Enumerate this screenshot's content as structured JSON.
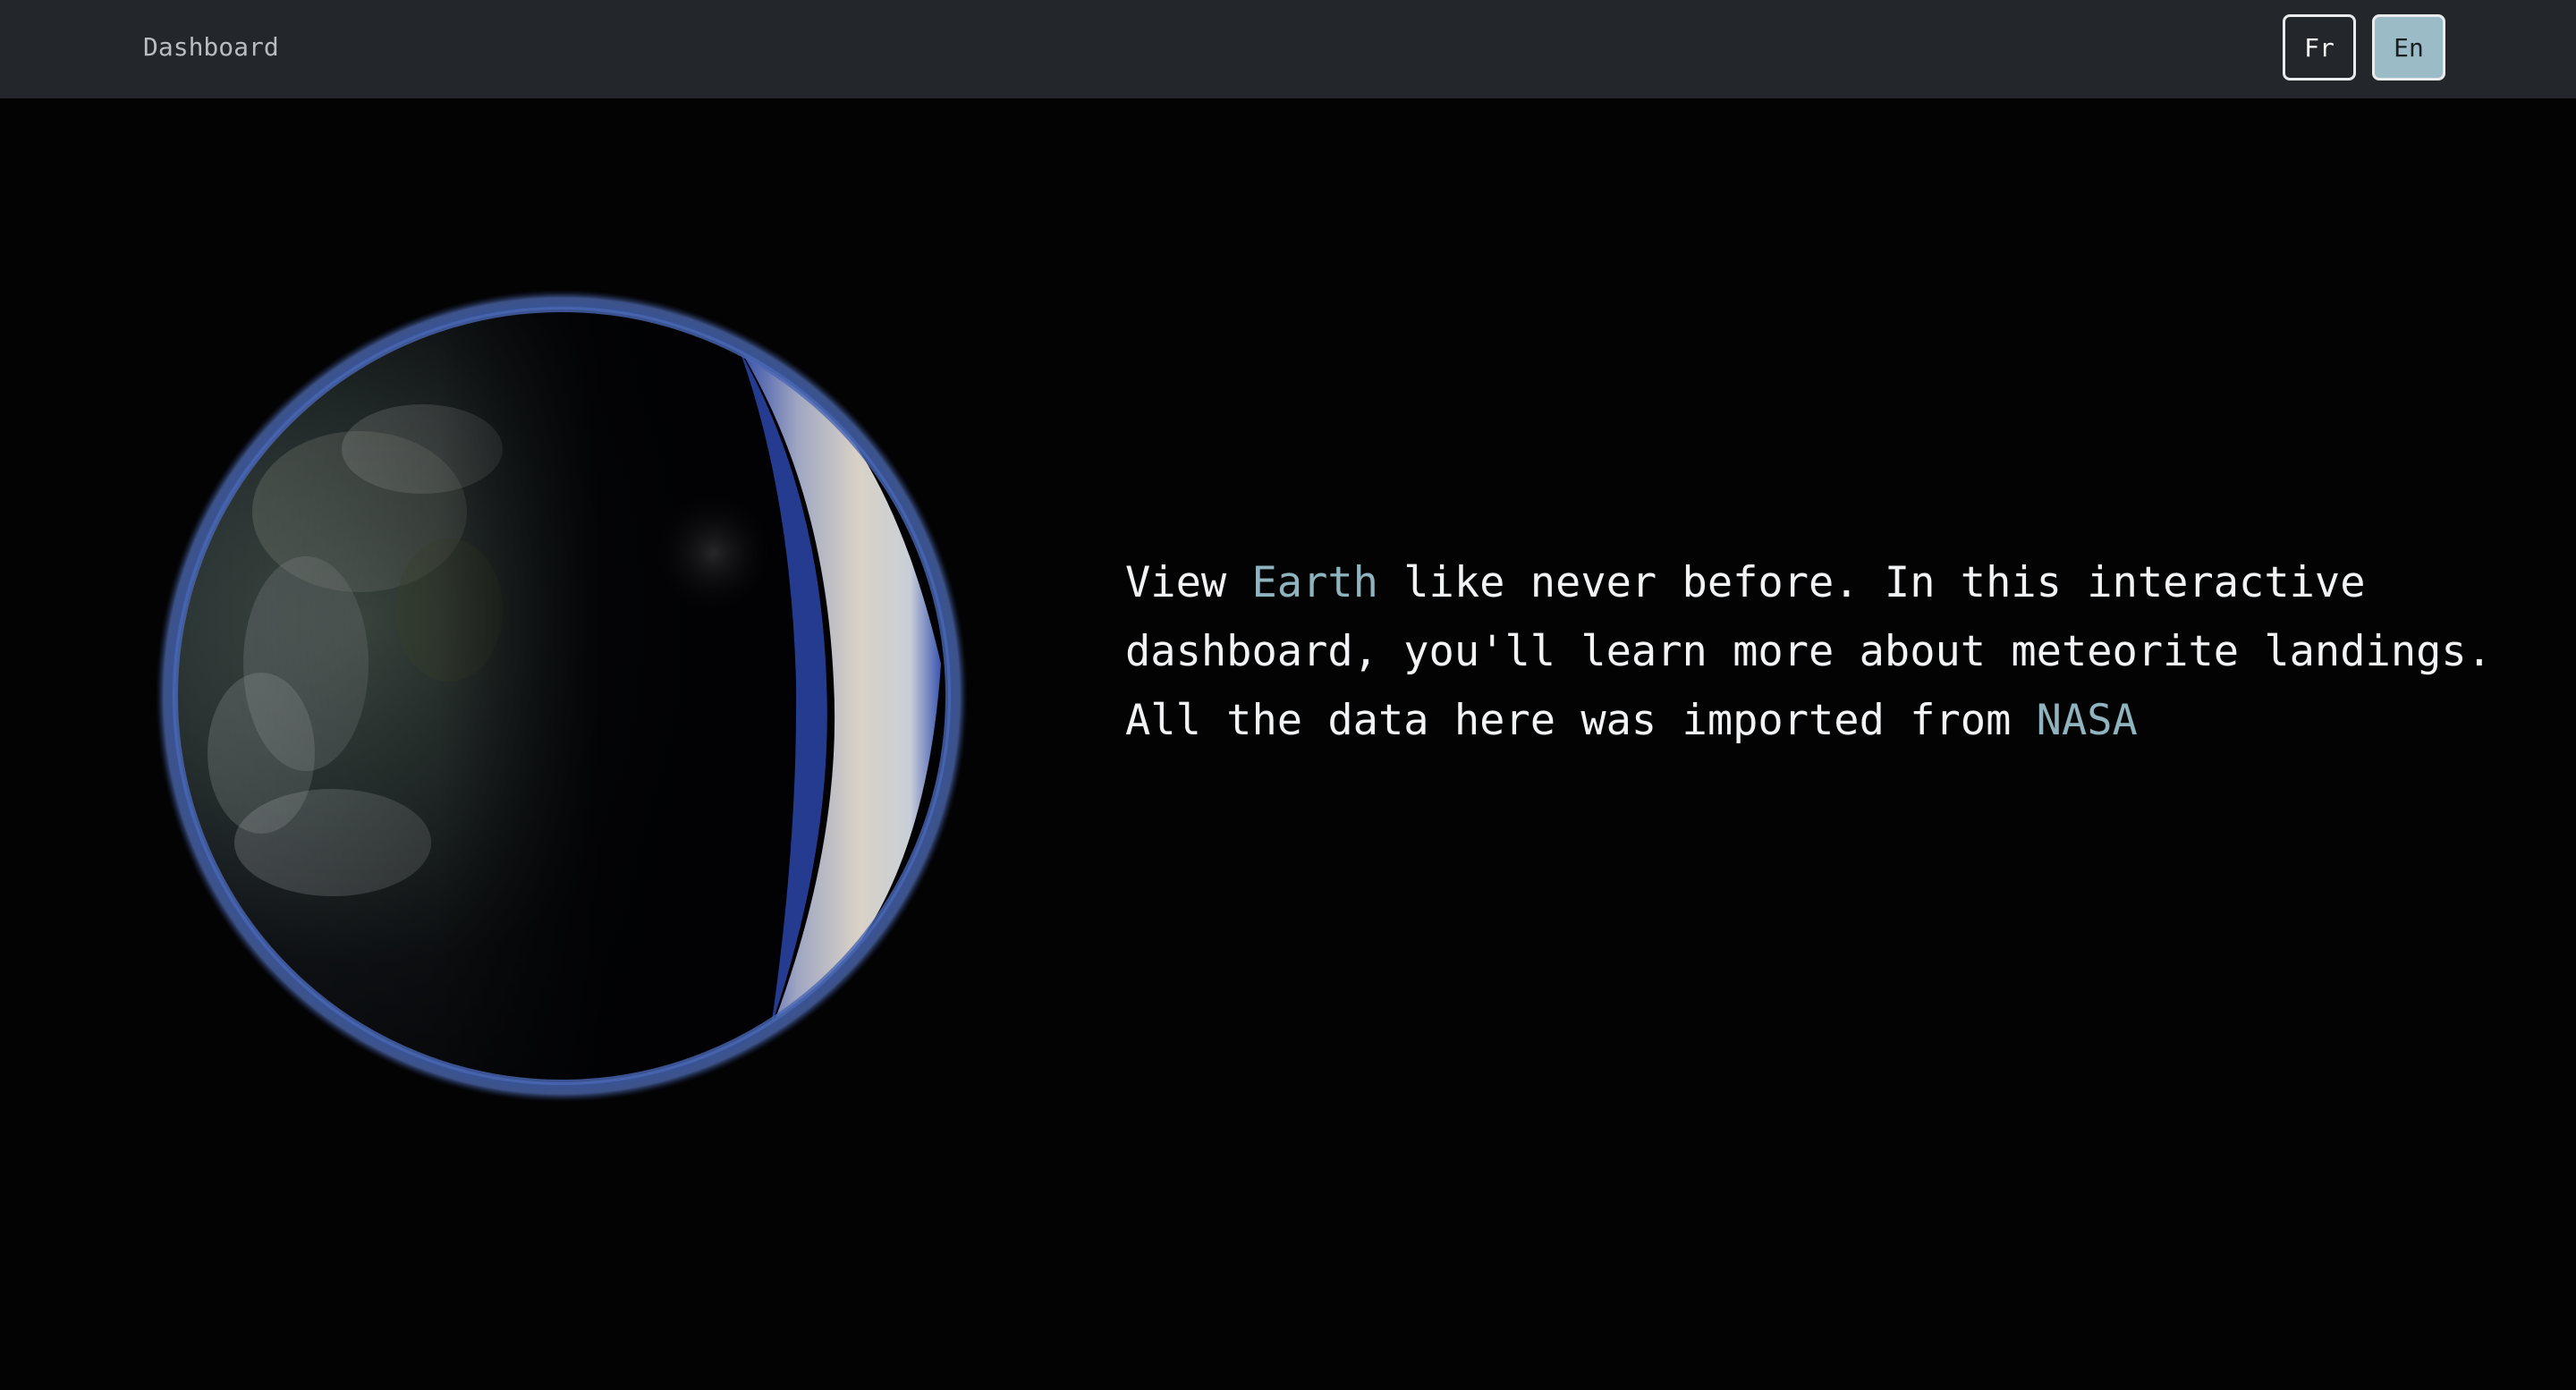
{
  "navbar": {
    "brand": "Dashboard",
    "languages": [
      {
        "code": "fr",
        "label": "Fr",
        "active": false
      },
      {
        "code": "en",
        "label": "En",
        "active": true
      }
    ]
  },
  "hero": {
    "image": "earth-globe",
    "text_part1": "View ",
    "highlight1": "Earth",
    "text_part2": " like never before. In this interactive dashboard, you'll learn more about meteorite landings. All the data here was imported from ",
    "highlight2": "NASA"
  },
  "colors": {
    "navbar_bg": "#23262b",
    "page_bg": "#030304",
    "accent": "#8fb3bf",
    "active_button_bg": "#9bbcc7"
  }
}
